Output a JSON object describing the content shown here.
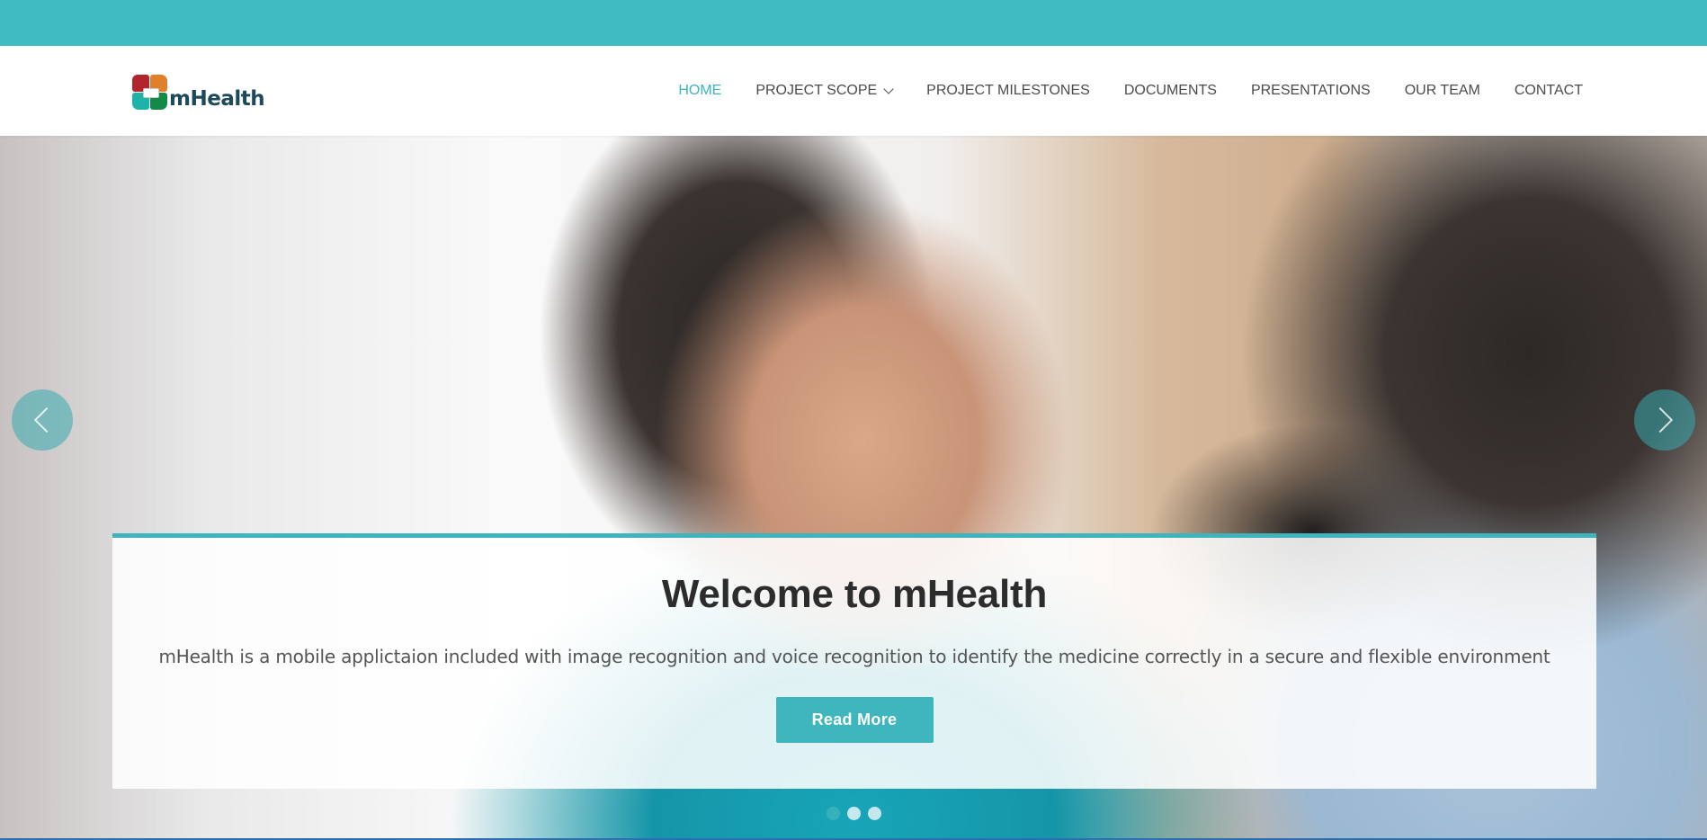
{
  "site": {
    "logo_text": "mHealth",
    "accent_color": "#3fb4bd"
  },
  "nav": {
    "items": [
      {
        "label": "HOME",
        "active": true
      },
      {
        "label": "PROJECT SCOPE",
        "has_dropdown": true
      },
      {
        "label": "PROJECT MILESTONES"
      },
      {
        "label": "DOCUMENTS"
      },
      {
        "label": "PRESENTATIONS"
      },
      {
        "label": "OUR TEAM"
      },
      {
        "label": "CONTACT"
      }
    ]
  },
  "hero": {
    "title": "Welcome to mHealth",
    "description": "mHealth is a mobile applictaion included with image recognition and voice recognition to identify the medicine correctly in a secure and flexible environment",
    "button_label": "Read More",
    "slides_count": 3,
    "active_slide": 1,
    "icons": {
      "prev": "chevron-left-icon",
      "next": "chevron-right-icon"
    }
  }
}
